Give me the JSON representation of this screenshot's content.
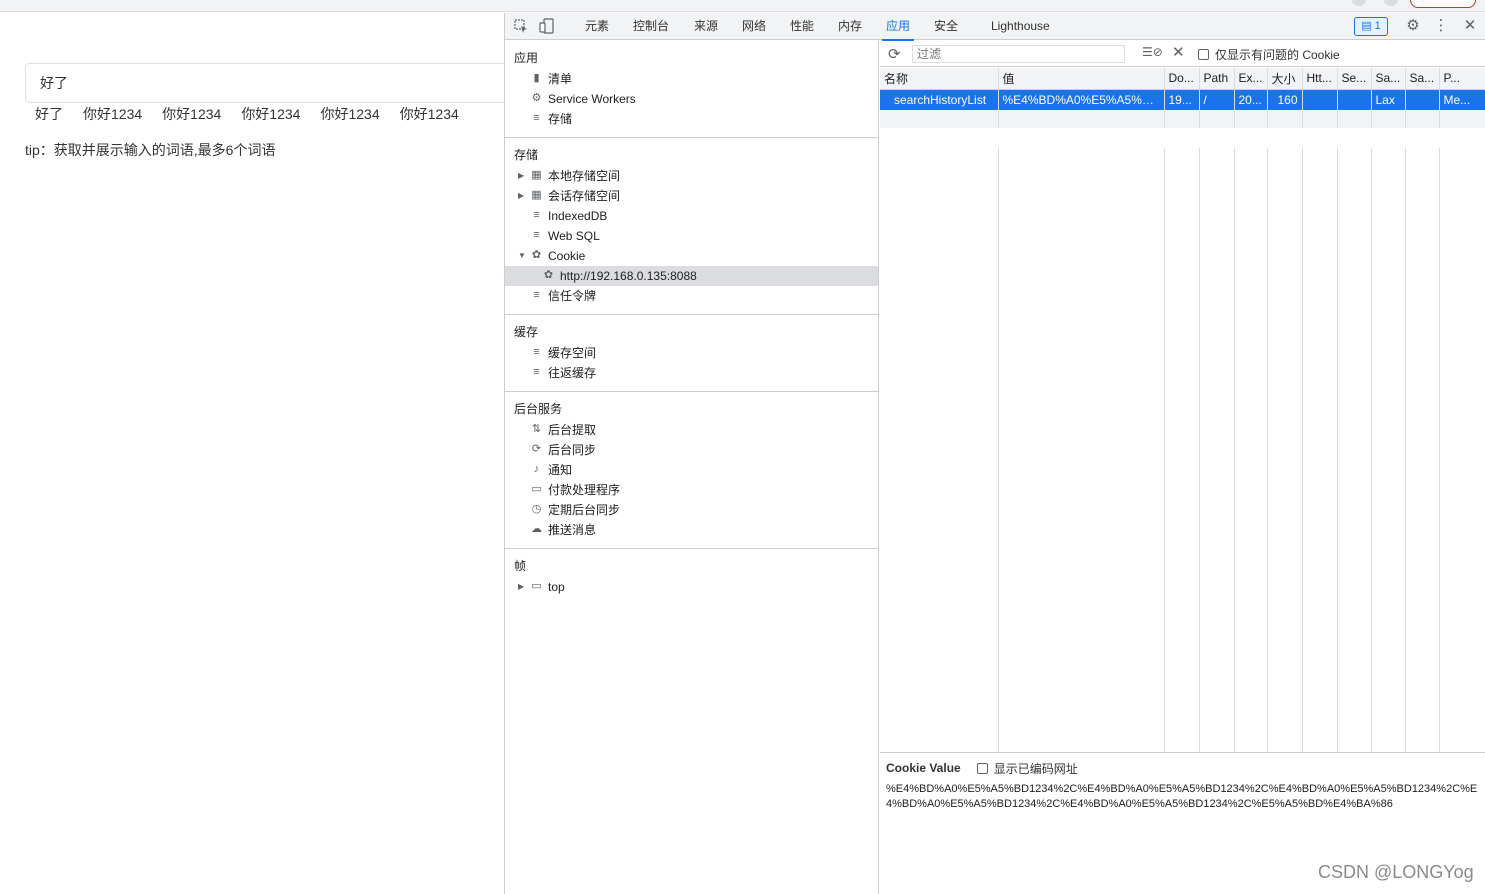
{
  "page": {
    "search_value": "好了",
    "history": [
      "好了",
      "你好1234",
      "你好1234",
      "你好1234",
      "你好1234",
      "你好1234"
    ],
    "tip": "tip：获取并展示输入的词语,最多6个词语"
  },
  "devtools": {
    "tabs": [
      "元素",
      "控制台",
      "来源",
      "网络",
      "性能",
      "内存",
      "应用",
      "安全",
      "Lighthouse"
    ],
    "active_tab": "应用",
    "issue_count": "1",
    "sidebar": {
      "app": {
        "title": "应用",
        "items": [
          "清单",
          "Service Workers",
          "存储"
        ]
      },
      "storage": {
        "title": "存储",
        "items": [
          "本地存储空间",
          "会话存储空间",
          "IndexedDB",
          "Web SQL",
          "Cookie",
          "http://192.168.0.135:8088",
          "信任令牌"
        ]
      },
      "cache": {
        "title": "缓存",
        "items": [
          "缓存空间",
          "往返缓存"
        ]
      },
      "background": {
        "title": "后台服务",
        "items": [
          "后台提取",
          "后台同步",
          "通知",
          "付款处理程序",
          "定期后台同步",
          "推送消息"
        ]
      },
      "frames": {
        "title": "帧",
        "items": [
          "top"
        ]
      }
    },
    "toolbar": {
      "filter_placeholder": "过滤",
      "only_issues_label": "仅显示有问题的 Cookie"
    },
    "table": {
      "columns": [
        "名称",
        "值",
        "Do...",
        "Path",
        "Ex...",
        "大小",
        "Htt...",
        "Se...",
        "Sa...",
        "Sa...",
        "P..."
      ],
      "rows": [
        [
          "searchHistoryList",
          "%E4%BD%A0%E5%A5%BD...",
          "19...",
          "/",
          "20...",
          "160",
          "",
          "",
          "Lax",
          "",
          "Me..."
        ]
      ]
    },
    "cookie_value": {
      "title": "Cookie Value",
      "show_encoded_label": "显示已编码网址",
      "value": "%E4%BD%A0%E5%A5%BD1234%2C%E4%BD%A0%E5%A5%BD1234%2C%E4%BD%A0%E5%A5%BD1234%2C%E4%BD%A0%E5%A5%BD1234%2C%E4%BD%A0%E5%A5%BD1234%2C%E5%A5%BD%E4%BA%86"
    }
  },
  "watermark": "CSDN @LONGYog"
}
